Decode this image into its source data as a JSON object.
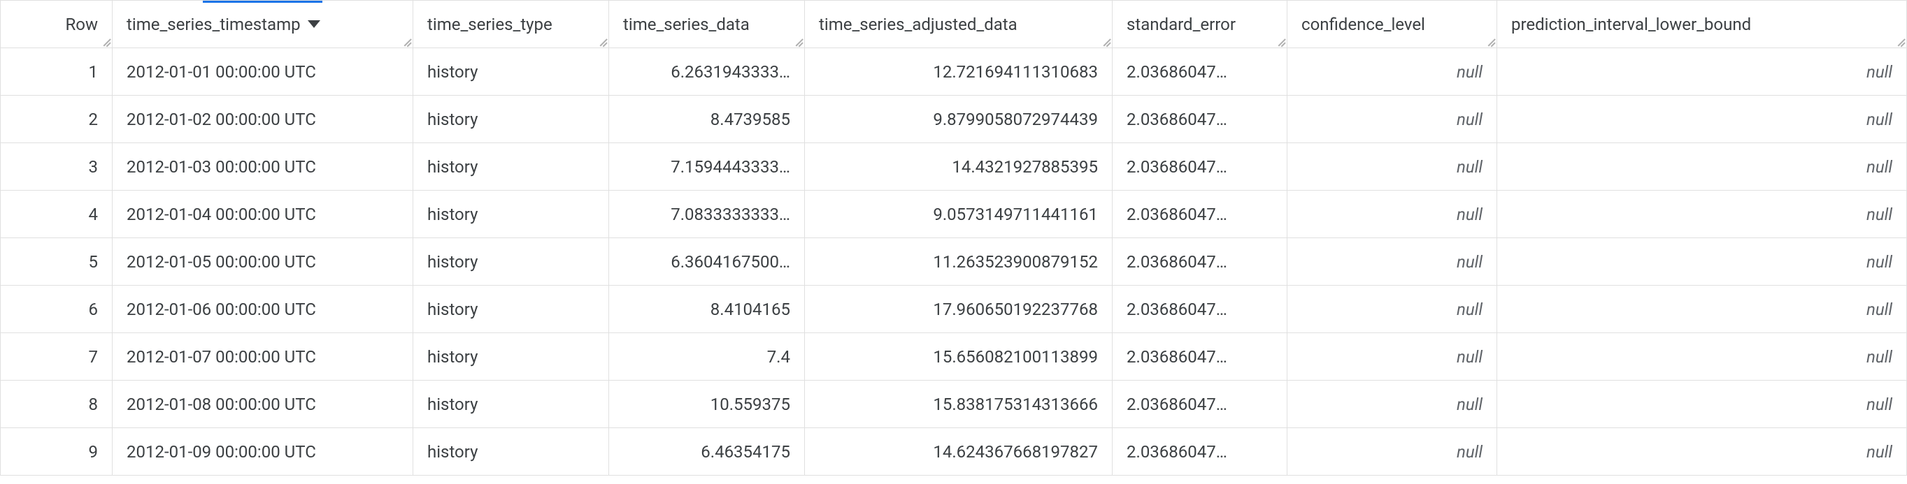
{
  "columns": [
    {
      "key": "row_index",
      "label": "Row",
      "sortable": false
    },
    {
      "key": "time_series_timestamp",
      "label": "time_series_timestamp",
      "sortable": true,
      "sorted": "asc"
    },
    {
      "key": "time_series_type",
      "label": "time_series_type",
      "sortable": true
    },
    {
      "key": "time_series_data",
      "label": "time_series_data",
      "sortable": true
    },
    {
      "key": "time_series_adjusted_data",
      "label": "time_series_adjusted_data",
      "sortable": true
    },
    {
      "key": "standard_error",
      "label": "standard_error",
      "sortable": true
    },
    {
      "key": "confidence_level",
      "label": "confidence_level",
      "sortable": true
    },
    {
      "key": "prediction_interval_lower_bound",
      "label": "prediction_interval_lower_bound",
      "sortable": true
    }
  ],
  "null_label": "null",
  "rows": [
    {
      "idx": "1",
      "ts": "2012-01-01 00:00:00 UTC",
      "type": "history",
      "data": "6.2631943333…",
      "adj": "12.721694111310683",
      "err": "2.03686047…",
      "conf": null,
      "pred": null
    },
    {
      "idx": "2",
      "ts": "2012-01-02 00:00:00 UTC",
      "type": "history",
      "data": "8.4739585",
      "adj": "9.8799058072974439",
      "err": "2.03686047…",
      "conf": null,
      "pred": null
    },
    {
      "idx": "3",
      "ts": "2012-01-03 00:00:00 UTC",
      "type": "history",
      "data": "7.1594443333…",
      "adj": "14.4321927885395",
      "err": "2.03686047…",
      "conf": null,
      "pred": null
    },
    {
      "idx": "4",
      "ts": "2012-01-04 00:00:00 UTC",
      "type": "history",
      "data": "7.0833333333…",
      "adj": "9.0573149711441161",
      "err": "2.03686047…",
      "conf": null,
      "pred": null
    },
    {
      "idx": "5",
      "ts": "2012-01-05 00:00:00 UTC",
      "type": "history",
      "data": "6.3604167500…",
      "adj": "11.263523900879152",
      "err": "2.03686047…",
      "conf": null,
      "pred": null
    },
    {
      "idx": "6",
      "ts": "2012-01-06 00:00:00 UTC",
      "type": "history",
      "data": "8.4104165",
      "adj": "17.960650192237768",
      "err": "2.03686047…",
      "conf": null,
      "pred": null
    },
    {
      "idx": "7",
      "ts": "2012-01-07 00:00:00 UTC",
      "type": "history",
      "data": "7.4",
      "adj": "15.656082100113899",
      "err": "2.03686047…",
      "conf": null,
      "pred": null
    },
    {
      "idx": "8",
      "ts": "2012-01-08 00:00:00 UTC",
      "type": "history",
      "data": "10.559375",
      "adj": "15.838175314313666",
      "err": "2.03686047…",
      "conf": null,
      "pred": null
    },
    {
      "idx": "9",
      "ts": "2012-01-09 00:00:00 UTC",
      "type": "history",
      "data": "6.46354175",
      "adj": "14.624367668197827",
      "err": "2.03686047…",
      "conf": null,
      "pred": null
    }
  ]
}
